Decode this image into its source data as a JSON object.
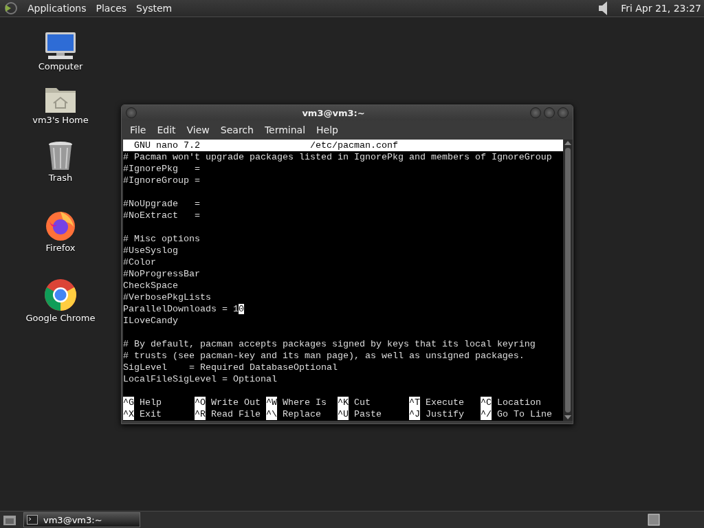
{
  "top_panel": {
    "menus": [
      "Applications",
      "Places",
      "System"
    ],
    "clock": "Fri Apr 21, 23:27"
  },
  "desktop_icons": [
    {
      "label": "Computer",
      "kind": "computer"
    },
    {
      "label": "vm3's Home",
      "kind": "home"
    },
    {
      "label": "Trash",
      "kind": "trash"
    },
    {
      "label": "Firefox",
      "kind": "firefox"
    },
    {
      "label": "Google Chrome",
      "kind": "chrome"
    }
  ],
  "window": {
    "title": "vm3@vm3:~",
    "menu": [
      "File",
      "Edit",
      "View",
      "Search",
      "Terminal",
      "Help"
    ],
    "nano": {
      "version": "GNU nano 7.2",
      "file": "/etc/pacman.conf",
      "blocks": [
        [
          {
            "text": "# Pacman won't upgrade packages listed in IgnorePkg and members of IgnoreGroup"
          },
          {
            "text": "#IgnorePkg   ="
          },
          {
            "text": "#IgnoreGroup ="
          }
        ],
        [
          {
            "text": "#NoUpgrade   ="
          },
          {
            "text": "#NoExtract   ="
          }
        ],
        [
          {
            "text": "# Misc options"
          },
          {
            "text": "#UseSyslog"
          },
          {
            "text": "#Color"
          },
          {
            "text": "#NoProgressBar"
          },
          {
            "text": "CheckSpace"
          },
          {
            "text": "#VerbosePkgLists"
          },
          {
            "text": "ParallelDownloads = 1",
            "cursor": "0"
          },
          {
            "text": "ILoveCandy"
          }
        ],
        [
          {
            "text": "# By default, pacman accepts packages signed by keys that its local keyring"
          },
          {
            "text": "# trusts (see pacman-key and its man page), as well as unsigned packages."
          },
          {
            "text": "SigLevel    = Required DatabaseOptional"
          },
          {
            "text": "LocalFileSigLevel = Optional"
          }
        ]
      ],
      "shortcuts": [
        [
          {
            "key": "^G",
            "label": "Help"
          },
          {
            "key": "^O",
            "label": "Write Out"
          },
          {
            "key": "^W",
            "label": "Where Is"
          },
          {
            "key": "^K",
            "label": "Cut"
          },
          {
            "key": "^T",
            "label": "Execute"
          },
          {
            "key": "^C",
            "label": "Location"
          }
        ],
        [
          {
            "key": "^X",
            "label": "Exit"
          },
          {
            "key": "^R",
            "label": "Read File"
          },
          {
            "key": "^\\",
            "label": "Replace"
          },
          {
            "key": "^U",
            "label": "Paste"
          },
          {
            "key": "^J",
            "label": "Justify"
          },
          {
            "key": "^/",
            "label": "Go To Line"
          }
        ]
      ]
    }
  },
  "taskbar": {
    "tasks": [
      {
        "label": "vm3@vm3:~",
        "selected": true
      }
    ]
  }
}
